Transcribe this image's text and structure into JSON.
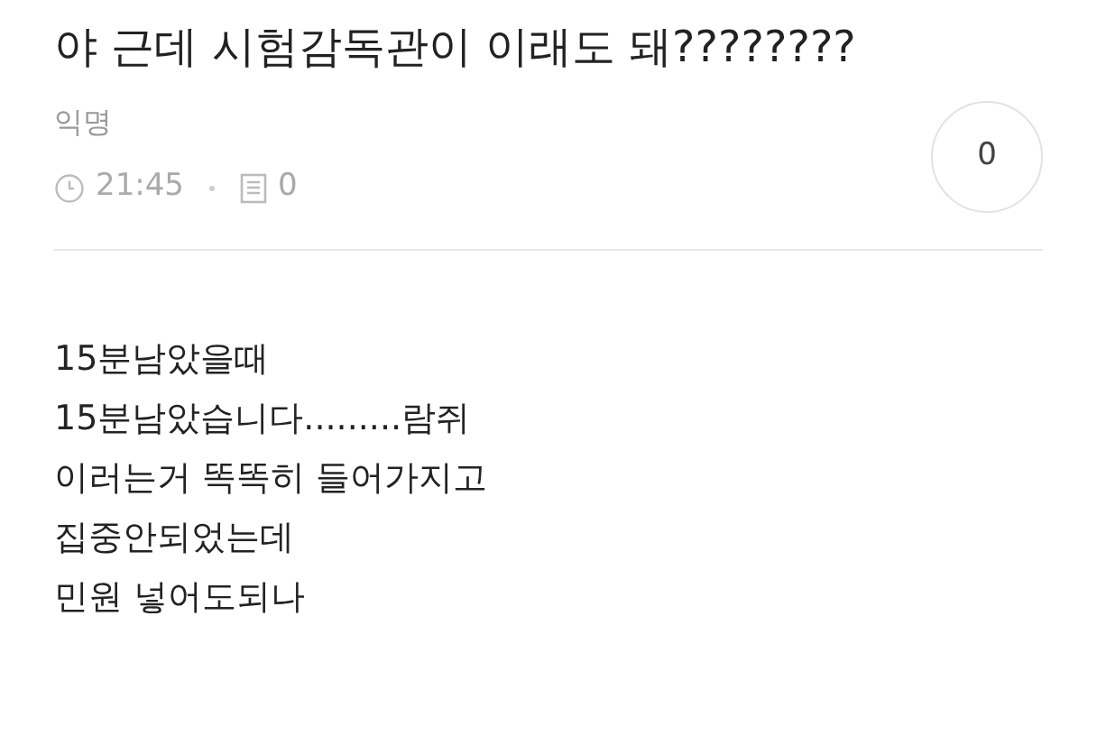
{
  "post": {
    "title": "야 근데 시험감독관이 이래도 돼????????",
    "author": "익명",
    "time": "21:45",
    "comment_count": "0",
    "like_count": "0"
  },
  "body": [
    "15분남았을때",
    "15분남았습니다.........람쥐",
    "이러는거 똑똑히 들어가지고",
    "집중안되었는데",
    "민원 넣어도되나"
  ]
}
